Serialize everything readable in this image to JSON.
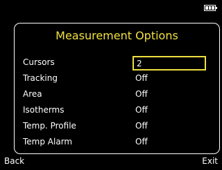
{
  "status": {
    "battery_icon": "battery-icon"
  },
  "dialog": {
    "title": "Measurement Options",
    "options": [
      {
        "label": "Cursors",
        "value": "2",
        "selected": true
      },
      {
        "label": "Tracking",
        "value": "Off"
      },
      {
        "label": "Area",
        "value": "Off"
      },
      {
        "label": "Isotherms",
        "value": "Off"
      },
      {
        "label": "Temp. Profile",
        "value": "Off"
      },
      {
        "label": "Temp Alarm",
        "value": "Off"
      }
    ]
  },
  "softkeys": {
    "left": "Back",
    "right": "Exit"
  },
  "colors": {
    "accent": "#f0e040",
    "background": "#000000",
    "text": "#ffffff"
  }
}
